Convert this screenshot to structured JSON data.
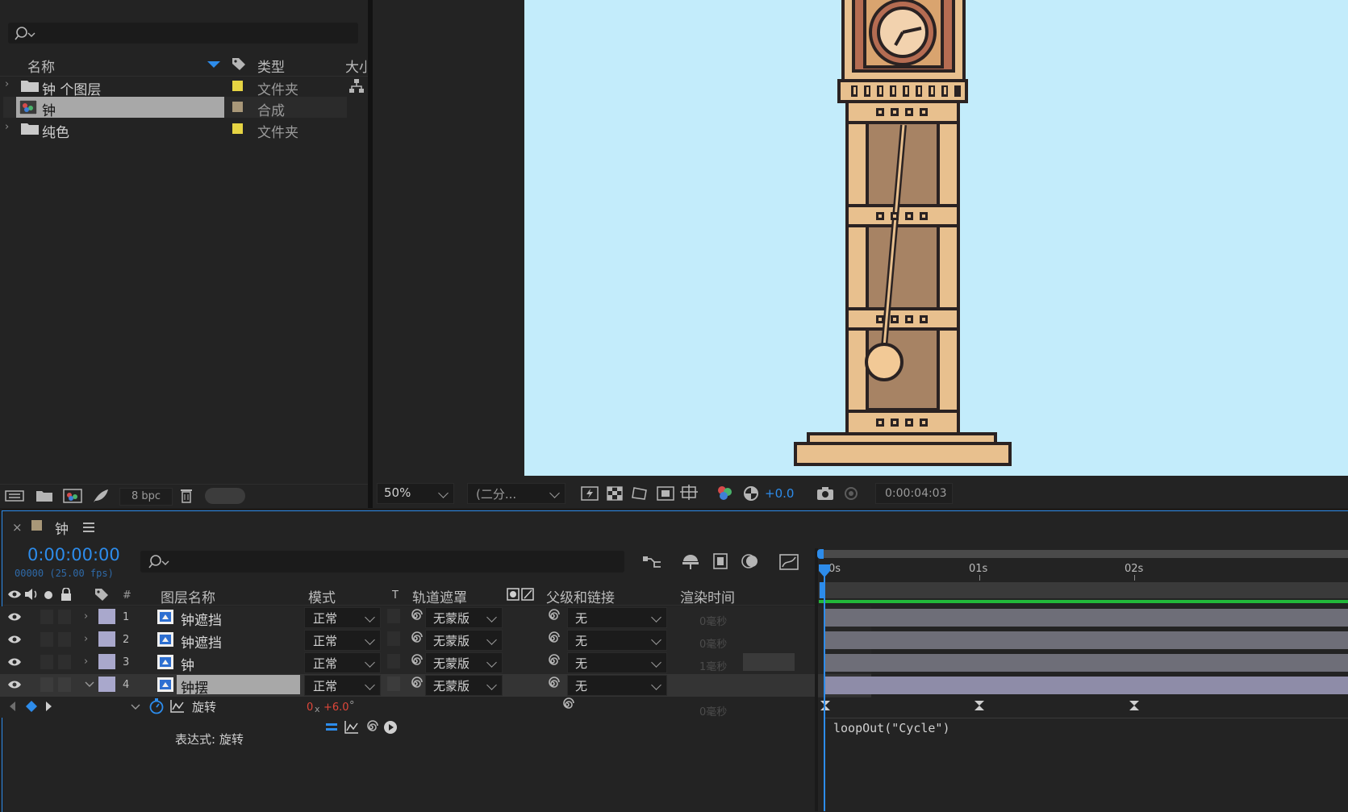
{
  "project": {
    "headers": {
      "name": "名称",
      "type": "类型",
      "size": "大小"
    },
    "items": [
      {
        "name": "钟 个图层",
        "type": "文件夹",
        "color": "#e6d443",
        "kind": "folder"
      },
      {
        "name": "钟",
        "type": "合成",
        "color": "#a89778",
        "kind": "comp"
      },
      {
        "name": "纯色",
        "type": "文件夹",
        "color": "#e6d443",
        "kind": "folder"
      }
    ],
    "bpc": "8 bpc"
  },
  "viewer": {
    "zoom": "50%",
    "resolution": "(二分...",
    "exposure": "+0.0",
    "timecode": "0:00:04:03",
    "bg_color": "#c3ecfb"
  },
  "timeline": {
    "tab_title": "钟",
    "timecode": "0:00:00:00",
    "frame_info": "00000 (25.00 fps)",
    "ruler": [
      "0s",
      "01s",
      "02s"
    ],
    "columns": {
      "num": "#",
      "layer_name": "图层名称",
      "mode": "模式",
      "t": "T",
      "track_matte": "轨道遮罩",
      "parent": "父级和链接",
      "render_time": "渲染时间"
    },
    "layers": [
      {
        "num": "1",
        "name": "钟遮挡",
        "mode": "正常",
        "matte": "无蒙版",
        "parent": "无",
        "render": "0毫秒"
      },
      {
        "num": "2",
        "name": "钟遮挡",
        "mode": "正常",
        "matte": "无蒙版",
        "parent": "无",
        "render": "0毫秒"
      },
      {
        "num": "3",
        "name": "钟",
        "mode": "正常",
        "matte": "无蒙版",
        "parent": "无",
        "render": "1毫秒"
      },
      {
        "num": "4",
        "name": "钟摆",
        "mode": "正常",
        "matte": "无蒙版",
        "parent": "无",
        "render": ""
      }
    ],
    "property": {
      "name": "旋转",
      "value_turns": "0",
      "value_x": "x",
      "value_deg": "+6.0",
      "unit": "°",
      "render": "0毫秒"
    },
    "expression": {
      "label": "表达式: 旋转",
      "code": "loopOut(\"Cycle\")"
    },
    "accent_color": "#2d8ceb",
    "layer_color": "#a9a8cc"
  }
}
